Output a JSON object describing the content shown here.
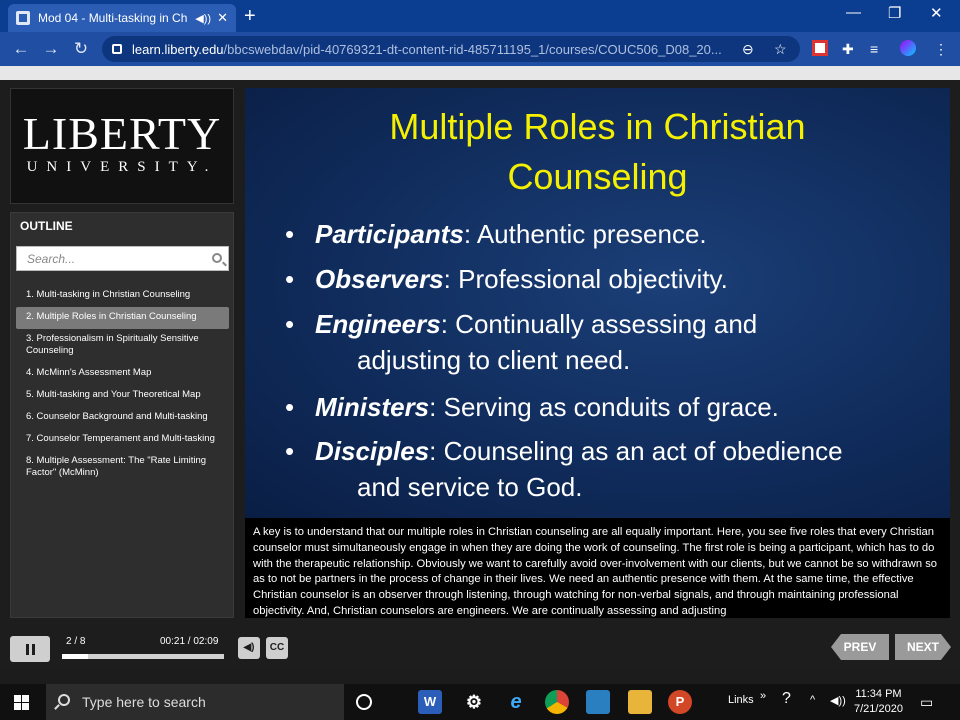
{
  "browser": {
    "tab_title": "Mod 04 - Multi-tasking in Ch",
    "url_host": "learn.liberty.edu",
    "url_path": "/bbcswebdav/pid-40769321-dt-content-rid-485711195_1/courses/COUC506_D08_20..."
  },
  "logo": {
    "line1": "LIBERTY",
    "line2": "UNIVERSITY."
  },
  "outline": {
    "heading": "OUTLINE",
    "search_placeholder": "Search...",
    "items": [
      "1. Multi-tasking in Christian Counseling",
      "2. Multiple Roles in Christian Counseling",
      "3. Professionalism in Spiritually Sensitive Counseling",
      "4. McMinn's Assessment Map",
      "5. Multi-tasking and Your Theoretical Map",
      "6. Counselor Background and Multi-tasking",
      "7. Counselor Temperament and Multi-tasking",
      "8. Multiple Assessment: The \"Rate Limiting Factor\" (McMinn)"
    ],
    "selected_index": 1
  },
  "slide": {
    "title_line1": "Multiple Roles in Christian",
    "title_line2": "Counseling",
    "bullets": [
      {
        "term": "Participants",
        "text": ":  Authentic presence.",
        "cont": ""
      },
      {
        "term": "Observers",
        "text": ":  Professional objectivity.",
        "cont": ""
      },
      {
        "term": "Engineers",
        "text": ":  Continually assessing and",
        "cont": "adjusting to client need."
      },
      {
        "term": "Ministers",
        "text": ":  Serving as conduits of grace.",
        "cont": ""
      },
      {
        "term": "Disciples",
        "text": ":  Counseling as an act of obedience",
        "cont": "and service to God."
      }
    ]
  },
  "caption": "A key is to understand that our multiple roles in Christian counseling are all equally important. Here, you see five roles that every Christian counselor must simultaneously engage in when they are doing the work of counseling. The first role is being a participant, which has to do with the therapeutic relationship. Obviously we want to carefully avoid over-involvement with our clients, but we cannot be so withdrawn so as to not be partners in the process of change in their lives. We need an authentic presence with them. At the same time, the effective Christian counselor is an observer through listening, through watching for non-verbal signals, and through maintaining professional objectivity. And, Christian counselors are engineers. We are continually assessing and adjusting",
  "controls": {
    "slide_counter": "2 / 8",
    "time": "00:21 / 02:09",
    "progress": 0.16,
    "cc_label": "CC",
    "prev_label": "PREV",
    "next_label": "NEXT"
  },
  "taskbar": {
    "search_placeholder": "Type here to search",
    "links_label": "Links",
    "time": "11:34 PM",
    "date": "7/21/2020"
  }
}
